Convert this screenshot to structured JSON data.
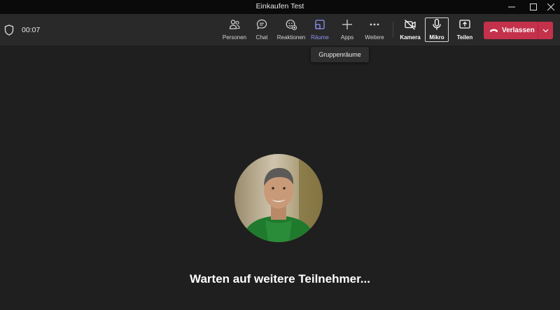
{
  "window": {
    "title": "Einkaufen Test",
    "controls": [
      "minimize-icon",
      "maximize-icon",
      "close-icon"
    ]
  },
  "meeting": {
    "timer": "00:07",
    "shield_icon": "shield-icon"
  },
  "toolbar": {
    "personen": "Personen",
    "chat": "Chat",
    "reaktionen": "Reaktionen",
    "raeume": "Räume",
    "apps": "Apps",
    "weitere": "Weitere",
    "kamera": "Kamera",
    "mikro": "Mikro",
    "teilen": "Teilen",
    "leave": "Verlassen",
    "active_accent": "#8f93f2",
    "leave_color": "#c4314b"
  },
  "tooltip": {
    "text": "Gruppenräume"
  },
  "stage": {
    "waiting_text": "Warten auf weitere Teilnehmer..."
  }
}
